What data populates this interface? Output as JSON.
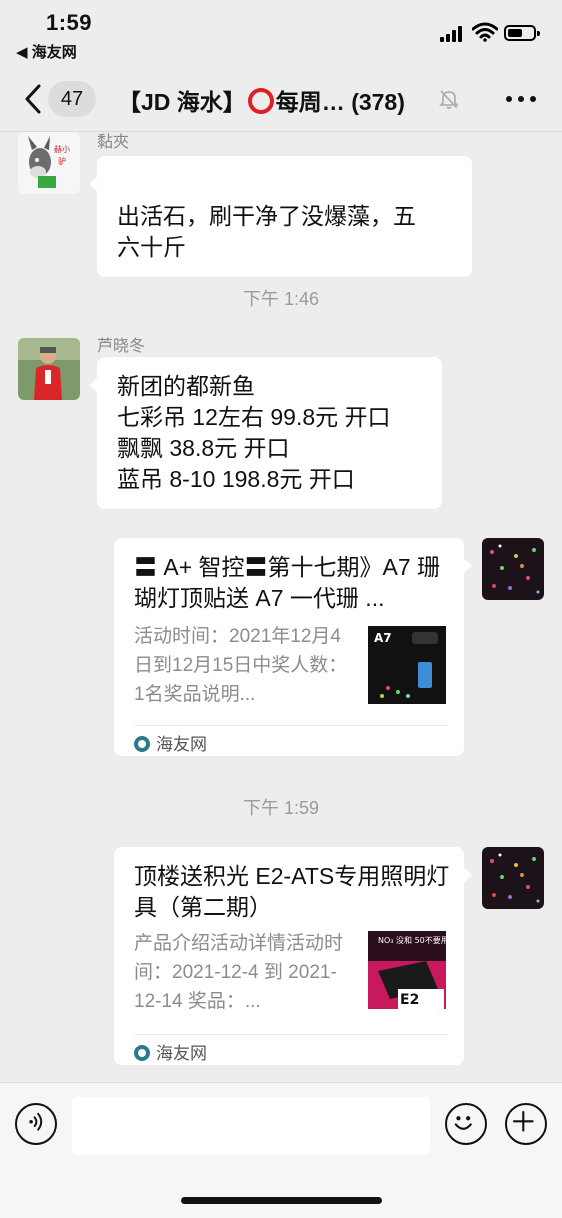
{
  "status_bar": {
    "time": "1:59",
    "back_app": "◀ 海友网"
  },
  "nav": {
    "back_count": "47",
    "title_prefix": "【JD 海水】",
    "title_suffix": "每周…",
    "member_count": "(378)"
  },
  "messages": [
    {
      "sender": "黏夾",
      "text": "出活石，刷干净了没爆藻，五\n六十斤"
    },
    {
      "time": "下午 1:46"
    },
    {
      "sender": "芦晓冬",
      "lines": [
        "新团的都新鱼",
        "七彩吊 12左右 99.8元 开口",
        "飘飘 38.8元 开口",
        "蓝吊 8-10 198.8元 开口"
      ]
    },
    {
      "card_title": "〓 A+ 智控〓第十七期》A7 珊 瑚灯顶贴送 A7 一代珊 ...",
      "card_desc": "活动时间：2021年12月4日到12月15日中奖人数：1名奖品说明...",
      "thumb_label": "A7",
      "source": "海友网"
    },
    {
      "time": "下午 1:59"
    },
    {
      "card_title": "顶楼送积光 E2-ATS专用照明灯具（第二期）",
      "card_desc": "产品介绍活动详情活动时间：2021-12-4 到 2021-12-14 奖品：...",
      "thumb_label_top": "NO₃ 没和 50不要用",
      "thumb_label": "E2",
      "source": "海友网"
    }
  ],
  "colors": {
    "background": "#ededed",
    "bubble": "#ffffff",
    "accent_red": "#e02020",
    "time_gray": "#9b9b9b"
  }
}
